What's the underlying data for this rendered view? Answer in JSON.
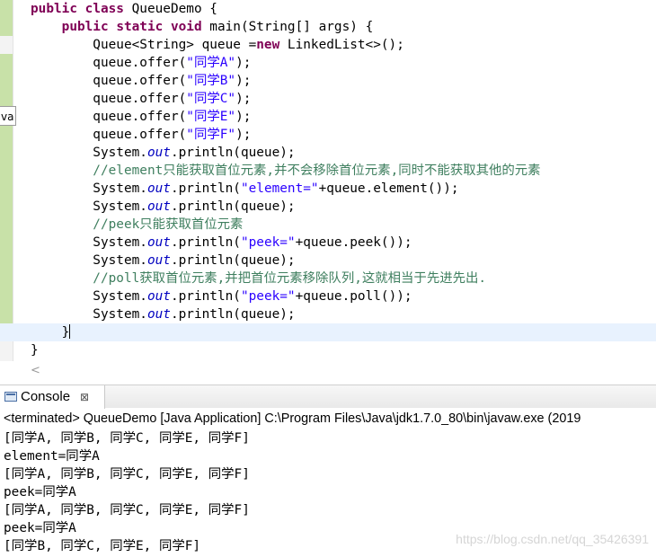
{
  "editor": {
    "side_tab": "va",
    "lines": [
      [
        {
          "t": "public ",
          "c": "kw"
        },
        {
          "t": "class ",
          "c": "kw"
        },
        {
          "t": "QueueDemo {",
          "c": ""
        }
      ],
      [
        {
          "t": "    ",
          "c": ""
        },
        {
          "t": "public ",
          "c": "kw"
        },
        {
          "t": "static ",
          "c": "kw"
        },
        {
          "t": "void ",
          "c": "kw"
        },
        {
          "t": "main(String[] args) {",
          "c": ""
        }
      ],
      [
        {
          "t": "        Queue<String> queue =",
          "c": ""
        },
        {
          "t": "new ",
          "c": "kw"
        },
        {
          "t": "LinkedList<>();",
          "c": ""
        }
      ],
      [
        {
          "t": "        queue.offer(",
          "c": ""
        },
        {
          "t": "\"同学A\"",
          "c": "str"
        },
        {
          "t": ");",
          "c": ""
        }
      ],
      [
        {
          "t": "        queue.offer(",
          "c": ""
        },
        {
          "t": "\"同学B\"",
          "c": "str"
        },
        {
          "t": ");",
          "c": ""
        }
      ],
      [
        {
          "t": "        queue.offer(",
          "c": ""
        },
        {
          "t": "\"同学C\"",
          "c": "str"
        },
        {
          "t": ");",
          "c": ""
        }
      ],
      [
        {
          "t": "        queue.offer(",
          "c": ""
        },
        {
          "t": "\"同学E\"",
          "c": "str"
        },
        {
          "t": ");",
          "c": ""
        }
      ],
      [
        {
          "t": "        queue.offer(",
          "c": ""
        },
        {
          "t": "\"同学F\"",
          "c": "str"
        },
        {
          "t": ");",
          "c": ""
        }
      ],
      [
        {
          "t": "        System.",
          "c": ""
        },
        {
          "t": "out",
          "c": "fld"
        },
        {
          "t": ".println(queue);",
          "c": ""
        }
      ],
      [
        {
          "t": "        //element只能获取首位元素,并不会移除首位元素,同时不能获取其他的元素",
          "c": "cmt"
        }
      ],
      [
        {
          "t": "        System.",
          "c": ""
        },
        {
          "t": "out",
          "c": "fld"
        },
        {
          "t": ".println(",
          "c": ""
        },
        {
          "t": "\"element=\"",
          "c": "str"
        },
        {
          "t": "+queue.element());",
          "c": ""
        }
      ],
      [
        {
          "t": "        System.",
          "c": ""
        },
        {
          "t": "out",
          "c": "fld"
        },
        {
          "t": ".println(queue);",
          "c": ""
        }
      ],
      [
        {
          "t": "        //peek只能获取首位元素",
          "c": "cmt"
        }
      ],
      [
        {
          "t": "        System.",
          "c": ""
        },
        {
          "t": "out",
          "c": "fld"
        },
        {
          "t": ".println(",
          "c": ""
        },
        {
          "t": "\"peek=\"",
          "c": "str"
        },
        {
          "t": "+queue.peek());",
          "c": ""
        }
      ],
      [
        {
          "t": "        System.",
          "c": ""
        },
        {
          "t": "out",
          "c": "fld"
        },
        {
          "t": ".println(queue);",
          "c": ""
        }
      ],
      [
        {
          "t": "        //poll获取首位元素,并把首位元素移除队列,这就相当于先进先出.",
          "c": "cmt"
        }
      ],
      [
        {
          "t": "        System.",
          "c": ""
        },
        {
          "t": "out",
          "c": "fld"
        },
        {
          "t": ".println(",
          "c": ""
        },
        {
          "t": "\"peek=\"",
          "c": "str"
        },
        {
          "t": "+queue.poll());",
          "c": ""
        }
      ],
      [
        {
          "t": "        System.",
          "c": ""
        },
        {
          "t": "out",
          "c": "fld"
        },
        {
          "t": ".println(queue);",
          "c": ""
        }
      ],
      [
        {
          "t": "    }",
          "c": ""
        }
      ],
      [
        {
          "t": "}",
          "c": ""
        }
      ]
    ],
    "scroll_left_arrow": "<"
  },
  "console": {
    "tab_label": "Console",
    "tab_close": "⊠",
    "status": "<terminated> QueueDemo [Java Application] C:\\Program Files\\Java\\jdk1.7.0_80\\bin\\javaw.exe (2019",
    "output": [
      "[同学A, 同学B, 同学C, 同学E, 同学F]",
      "element=同学A",
      "[同学A, 同学B, 同学C, 同学E, 同学F]",
      "peek=同学A",
      "[同学A, 同学B, 同学C, 同学E, 同学F]",
      "peek=同学A",
      "[同学B, 同学C, 同学E, 同学F]"
    ]
  },
  "watermark": "https://blog.csdn.net/qq_35426391"
}
